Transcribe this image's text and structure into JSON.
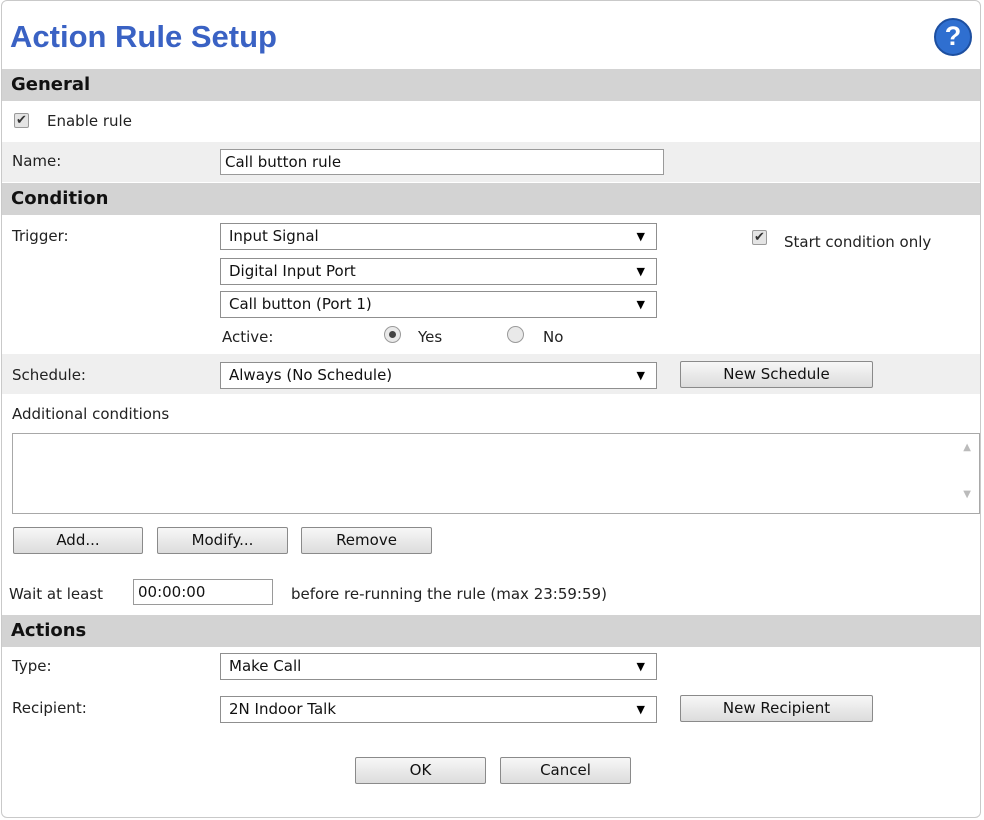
{
  "header": {
    "title": "Action Rule Setup",
    "help_glyph": "?"
  },
  "general": {
    "section_title": "General",
    "enable_rule_label": "Enable rule",
    "enable_rule_checked": true,
    "name_label": "Name:",
    "name_value": "Call button rule"
  },
  "condition": {
    "section_title": "Condition",
    "trigger_label": "Trigger:",
    "trigger_select": "Input Signal",
    "signal_select": "Digital Input Port",
    "port_select": "Call button (Port 1)",
    "start_condition_label": "Start condition only",
    "start_condition_checked": true,
    "active_label": "Active:",
    "active_yes": "Yes",
    "active_no": "No",
    "active_selected": "Yes",
    "schedule_label": "Schedule:",
    "schedule_select": "Always (No Schedule)",
    "new_schedule_button": "New Schedule",
    "additional_label": "Additional conditions",
    "additional_items": [],
    "add_button": "Add...",
    "modify_button": "Modify...",
    "remove_button": "Remove",
    "wait_label": "Wait at least",
    "wait_value": "00:00:00",
    "wait_suffix": "before re-running the rule (max 23:59:59)"
  },
  "actions": {
    "section_title": "Actions",
    "type_label": "Type:",
    "type_select": "Make Call",
    "recipient_label": "Recipient:",
    "recipient_select": "2N Indoor Talk",
    "new_recipient_button": "New Recipient"
  },
  "footer": {
    "ok_button": "OK",
    "cancel_button": "Cancel"
  },
  "icons": {
    "dropdown": "▼",
    "checkmark": "✔",
    "scroll_up": "▲",
    "scroll_down": "▼"
  },
  "colors": {
    "title": "#3a62c4",
    "section_bg": "#d3d3d3",
    "band_bg": "#efefef",
    "help_icon": "#2f6fd0"
  }
}
